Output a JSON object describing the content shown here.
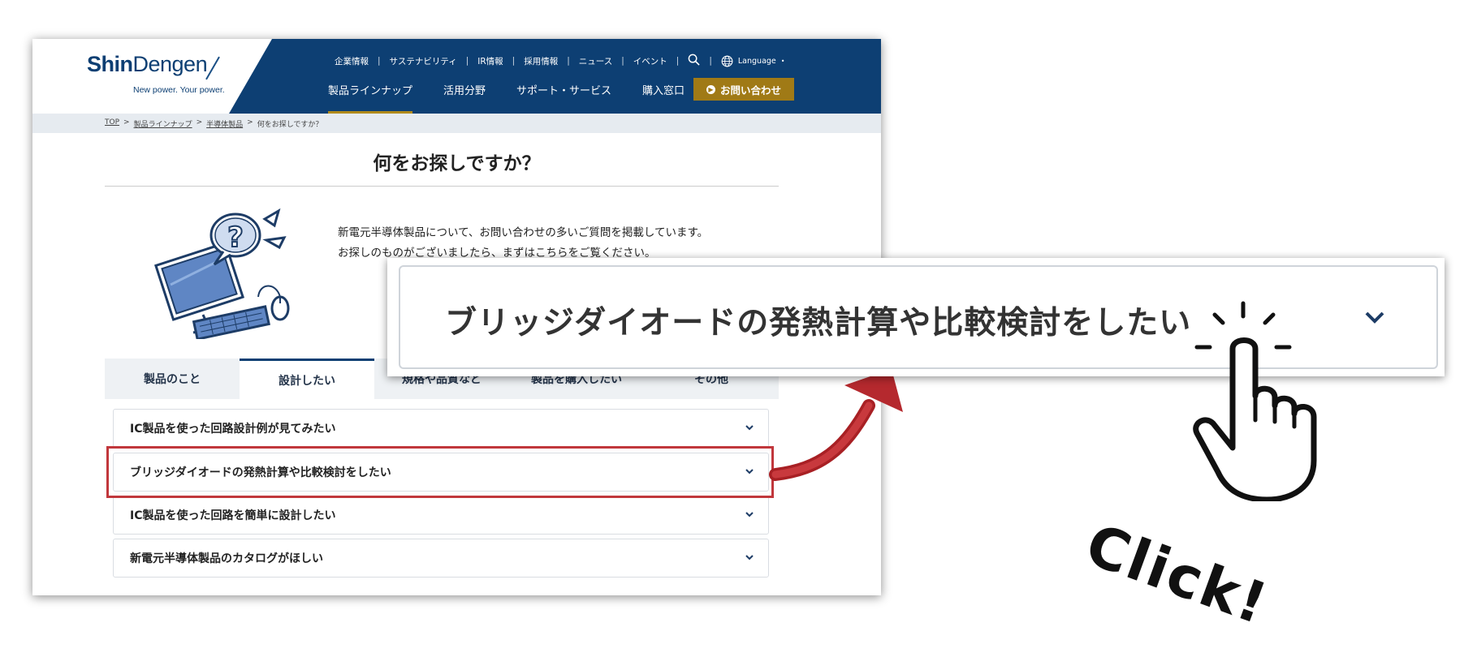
{
  "header": {
    "logo_text_bold": "Shin",
    "logo_text_rest": "Dengen",
    "tagline": "New power. Your power.",
    "top_nav": [
      "企業情報",
      "サステナビリティ",
      "IR情報",
      "採用情報",
      "ニュース",
      "イベント"
    ],
    "language_label": "Language",
    "main_nav": [
      "製品ラインナップ",
      "活用分野",
      "サポート・サービス",
      "購入窓口"
    ],
    "cta_label": "お問い合わせ"
  },
  "breadcrumb": {
    "items": [
      "TOP",
      "製品ラインナップ",
      "半導体製品",
      "何をお探しですか？"
    ],
    "separator": ">"
  },
  "page": {
    "title": "何をお探しですか？",
    "intro_line1": "新電元半導体製品について、お問い合わせの多いご質問を掲載しています。",
    "intro_line2": "お探しのものがございましたら、まずはこちらをご覧ください。"
  },
  "tabs": [
    {
      "label": "製品のこと"
    },
    {
      "label": "設計したい"
    },
    {
      "label": "規格や品質など"
    },
    {
      "label": "製品を購入したい"
    },
    {
      "label": "その他"
    }
  ],
  "faq": [
    {
      "label": "IC製品を使った回路設計例が見てみたい"
    },
    {
      "label": "ブリッジダイオードの発熱計算や比較検討をしたい"
    },
    {
      "label": "IC製品を使った回路を簡単に設計したい"
    },
    {
      "label": "新電元半導体製品のカタログがほしい"
    }
  ],
  "zoom": {
    "label": "ブリッジダイオードの発熱計算や比較検討をしたい"
  },
  "annotation": {
    "click_text": "Click!"
  },
  "colors": {
    "header_navy": "#0d3f73",
    "cta_gold": "#a07a16",
    "highlight_red": "#c1373c"
  }
}
